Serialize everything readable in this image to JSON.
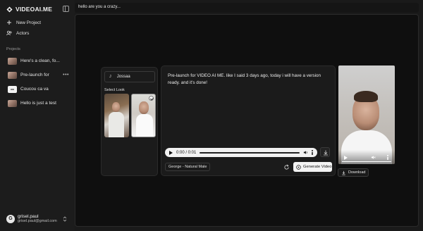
{
  "brand": {
    "name": "VIDEOAI.ME"
  },
  "nav": [
    {
      "label": "New Project",
      "icon": "plus-icon"
    },
    {
      "label": "Actors",
      "icon": "users-icon"
    }
  ],
  "projects": {
    "title": "Projects",
    "items": [
      {
        "label": "Here's a clean, fo...",
        "thumb": "face"
      },
      {
        "label": "Pre-launch for",
        "thumb": "face",
        "more": "•••"
      },
      {
        "label": "Coucou ca va",
        "thumb": "white"
      },
      {
        "label": "Hello is just a test",
        "thumb": "face"
      }
    ]
  },
  "user": {
    "initial": "G",
    "name": "grisel.paul",
    "email": "grisel.paul@gmail.com"
  },
  "prompt": {
    "text": "hello are you a crazy..."
  },
  "actor": {
    "initial": "J",
    "name": "Jossaa"
  },
  "look": {
    "title": "Select Look"
  },
  "script": {
    "text": "Pre-launch for VIDEO AI ME. like I said 3 days ago, today i will have a version ready. and it's done!"
  },
  "audio": {
    "time": "0:00 / 0:01"
  },
  "voice": {
    "label": "George - Natural Male"
  },
  "actions": {
    "generate": "Generate Video",
    "download": "Download"
  }
}
